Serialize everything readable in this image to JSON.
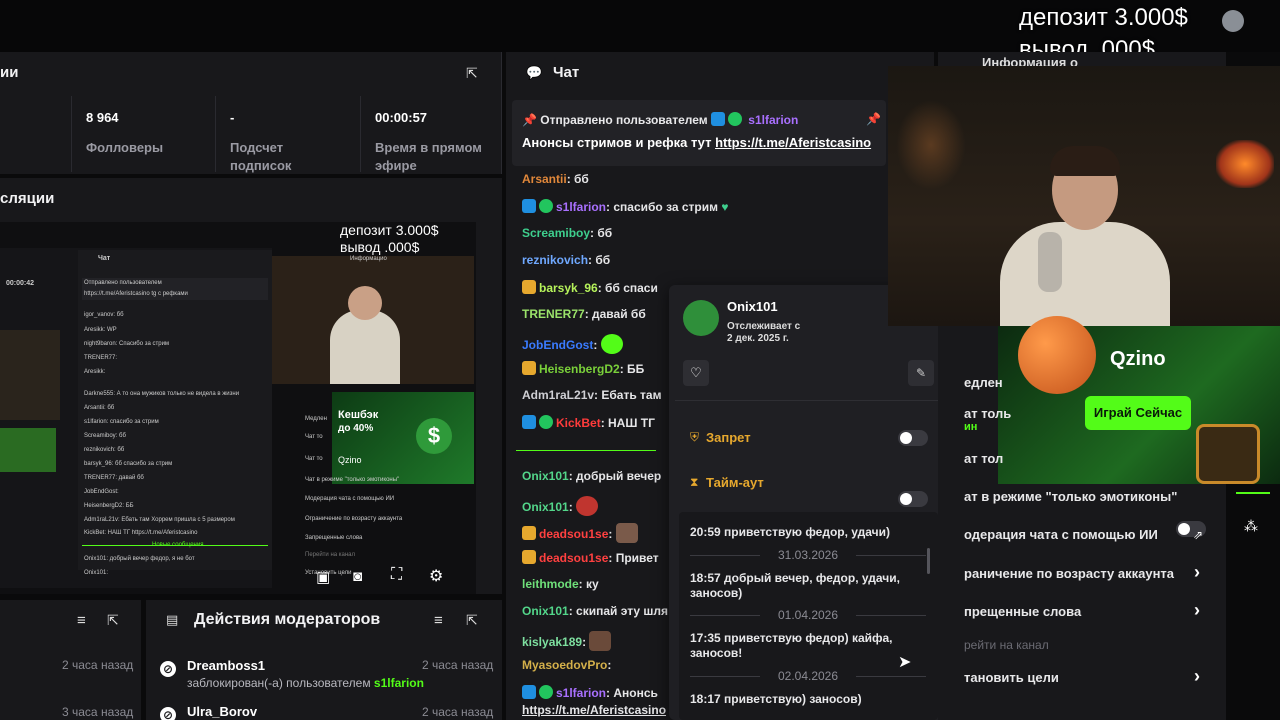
{
  "overlay": {
    "deposit": "депозит 3.000$",
    "withdraw": "вывод  .000$"
  },
  "left_panel": {
    "title_fragment": "ии",
    "stats": [
      {
        "value": "8 964",
        "label": "Фолловеры"
      },
      {
        "value": "-",
        "label": "Подсчет подписок"
      },
      {
        "value": "00:00:57",
        "label": "Время в прямом эфире"
      }
    ],
    "preview_title_fragment": "сляции"
  },
  "preview": {
    "deposit": "депозит 3.000$",
    "withdraw": "вывод  .000$",
    "chat_title": "Чат",
    "stream_time": "00:00:42",
    "info_fragment": "Информацио",
    "promo_title": "Кешбэк",
    "promo_sub": "до 40%",
    "promo_brand": "Qzino",
    "new_messages": "Новые сообщения",
    "settings": [
      "Медлен",
      "Чат то",
      "Чат то",
      "Чат в режиме \"только эмотиконы\"",
      "Модерация чата с помощью ИИ",
      "Ограничение по возрасту аккаунта",
      "Запрещенные слова",
      "Перейти на канал",
      "Установить цели"
    ],
    "lines": [
      "Отправлено пользователем",
      "https://t.me/Aferistcasino tg с рефками",
      "igor_vanov: бб",
      "Aresikk: WP",
      "night9baron: Спасибо за стрим",
      "TRENER77:",
      "Aresikk:",
      "Darkne555: А то она мужиков только не видела в жизни",
      "Arsantii: бб",
      "s1lfarion: спасибо за стрим",
      "Screamiboy: бб",
      "reznikovich: бб",
      "barsyk_96: бб спасибо за стрим",
      "TRENER77: давай бб",
      "JobEndGost:",
      "HeisenbergD2: ББ",
      "Adm1raL21v: Ебать там Хоррем пришла с 5 размером",
      "KickBet: НАШ ТГ https://t.me/Aferistcasino",
      "Onix101: добрый вечер федор, я не бот",
      "Onix101:"
    ]
  },
  "chat": {
    "title": "Чат",
    "pinned_label": "Отправлено пользователем",
    "pinned_user": "s1lfarion",
    "pinned_text": "Анонсы стримов и рефка тут ",
    "pinned_link": "https://t.me/Aferistcasino",
    "messages": [
      {
        "user": "Arsantii",
        "text": ": бб",
        "color": "#e0873a"
      },
      {
        "user": "s1lfarion",
        "text": ": спасибо за стрим ",
        "color": "#a970ff"
      },
      {
        "user": "Screamiboy",
        "text": ": бб",
        "color": "#3ecf8e"
      },
      {
        "user": "reznikovich",
        "text": ": бб",
        "color": "#6fa8ff"
      },
      {
        "user": "barsyk_96",
        "text": ": бб спаси",
        "color": "#b6f35b"
      },
      {
        "user": "TRENER77",
        "text": ": давай бб",
        "color": "#9be36a"
      },
      {
        "user": "JobEndGost",
        "text": ":",
        "color": "#3a7bff"
      },
      {
        "user": "HeisenbergD2",
        "text": ": ББ",
        "color": "#7ad03a"
      },
      {
        "user": "Adm1raL21v",
        "text": ": Ебать там",
        "color": "#cfcfd4"
      },
      {
        "user": "KickBet",
        "text": ": НАШ ТГ",
        "color": "#ff3b3b"
      },
      {
        "user": "Onix101",
        "text": ": добрый вечер",
        "color": "#53d68a"
      },
      {
        "user": "Onix101",
        "text": ":",
        "color": "#53d68a"
      },
      {
        "user": "deadsou1se",
        "text": ":",
        "color": "#ff4040"
      },
      {
        "user": "deadsou1se",
        "text": ": Привет",
        "color": "#ff4040"
      },
      {
        "user": "leithmode",
        "text": ": ку",
        "color": "#6fe07a"
      },
      {
        "user": "Onix101",
        "text": ": скипай эту шля",
        "color": "#53d68a"
      },
      {
        "user": "kislyak189",
        "text": ":",
        "color": "#7ee0a0"
      },
      {
        "user": "MyasoedovPro",
        "text": ":",
        "color": "#d4b04a"
      },
      {
        "user": "s1lfarion",
        "text": ": Анонсь",
        "color": "#a970ff"
      }
    ],
    "last_link": "https://t.me/Aferistcasino"
  },
  "user_card": {
    "name": "Onix101",
    "following_label": "Отслеживает с",
    "following_date": "2 дек. 2025 г.",
    "ban_label": "Запрет",
    "timeout_label": "Тайм-аут",
    "history": [
      {
        "type": "msg",
        "text": "20:59 приветствую федор, удачи)"
      },
      {
        "type": "date",
        "text": "31.03.2026"
      },
      {
        "type": "msg",
        "text": "18:57 добрый вечер, федор, удачи, заносов)"
      },
      {
        "type": "date",
        "text": "01.04.2026"
      },
      {
        "type": "msg",
        "text": "17:35 приветствую федор) кайфа, заносов!"
      },
      {
        "type": "date",
        "text": "02.04.2026"
      },
      {
        "type": "msg",
        "text": "18:17 приветствую) заносов)"
      }
    ]
  },
  "right_panel": {
    "info_fragment": "Информация о",
    "ad_brand": "Qzino",
    "ad_button": "Играй Сейчас",
    "items": [
      {
        "label": "едлен",
        "kind": "plain"
      },
      {
        "label": "ат толь",
        "kind": "plain"
      },
      {
        "label": "ат тол",
        "kind": "plain"
      },
      {
        "label": "ат в режиме \"только эмотиконы\"",
        "kind": "toggle"
      },
      {
        "label": "одерация чата с помощью ИИ",
        "kind": "external"
      },
      {
        "label": "раничение по возрасту аккаунта",
        "kind": "chevron"
      },
      {
        "label": "прещенные слова",
        "kind": "chevron"
      },
      {
        "label": "рейти на канал",
        "kind": "muted"
      },
      {
        "label": "тановить цели",
        "kind": "chevron"
      }
    ]
  },
  "bottom_left": {
    "rows": [
      {
        "time": "2 часа назад"
      },
      {
        "time": "3 часа назад"
      }
    ]
  },
  "mod_actions": {
    "title": "Действия модераторов",
    "rows": [
      {
        "name": "Dreamboss1",
        "action": "заблокирован(-а) пользователем ",
        "by": "s1lfarion",
        "time": "2 часа назад"
      },
      {
        "name": "Ulra_Borov",
        "action": "",
        "by": "",
        "time": "2 часа назад"
      }
    ]
  },
  "colors": {
    "accent_green": "#53fc18",
    "panel": "#18181b",
    "background": "#0a0a0b"
  }
}
